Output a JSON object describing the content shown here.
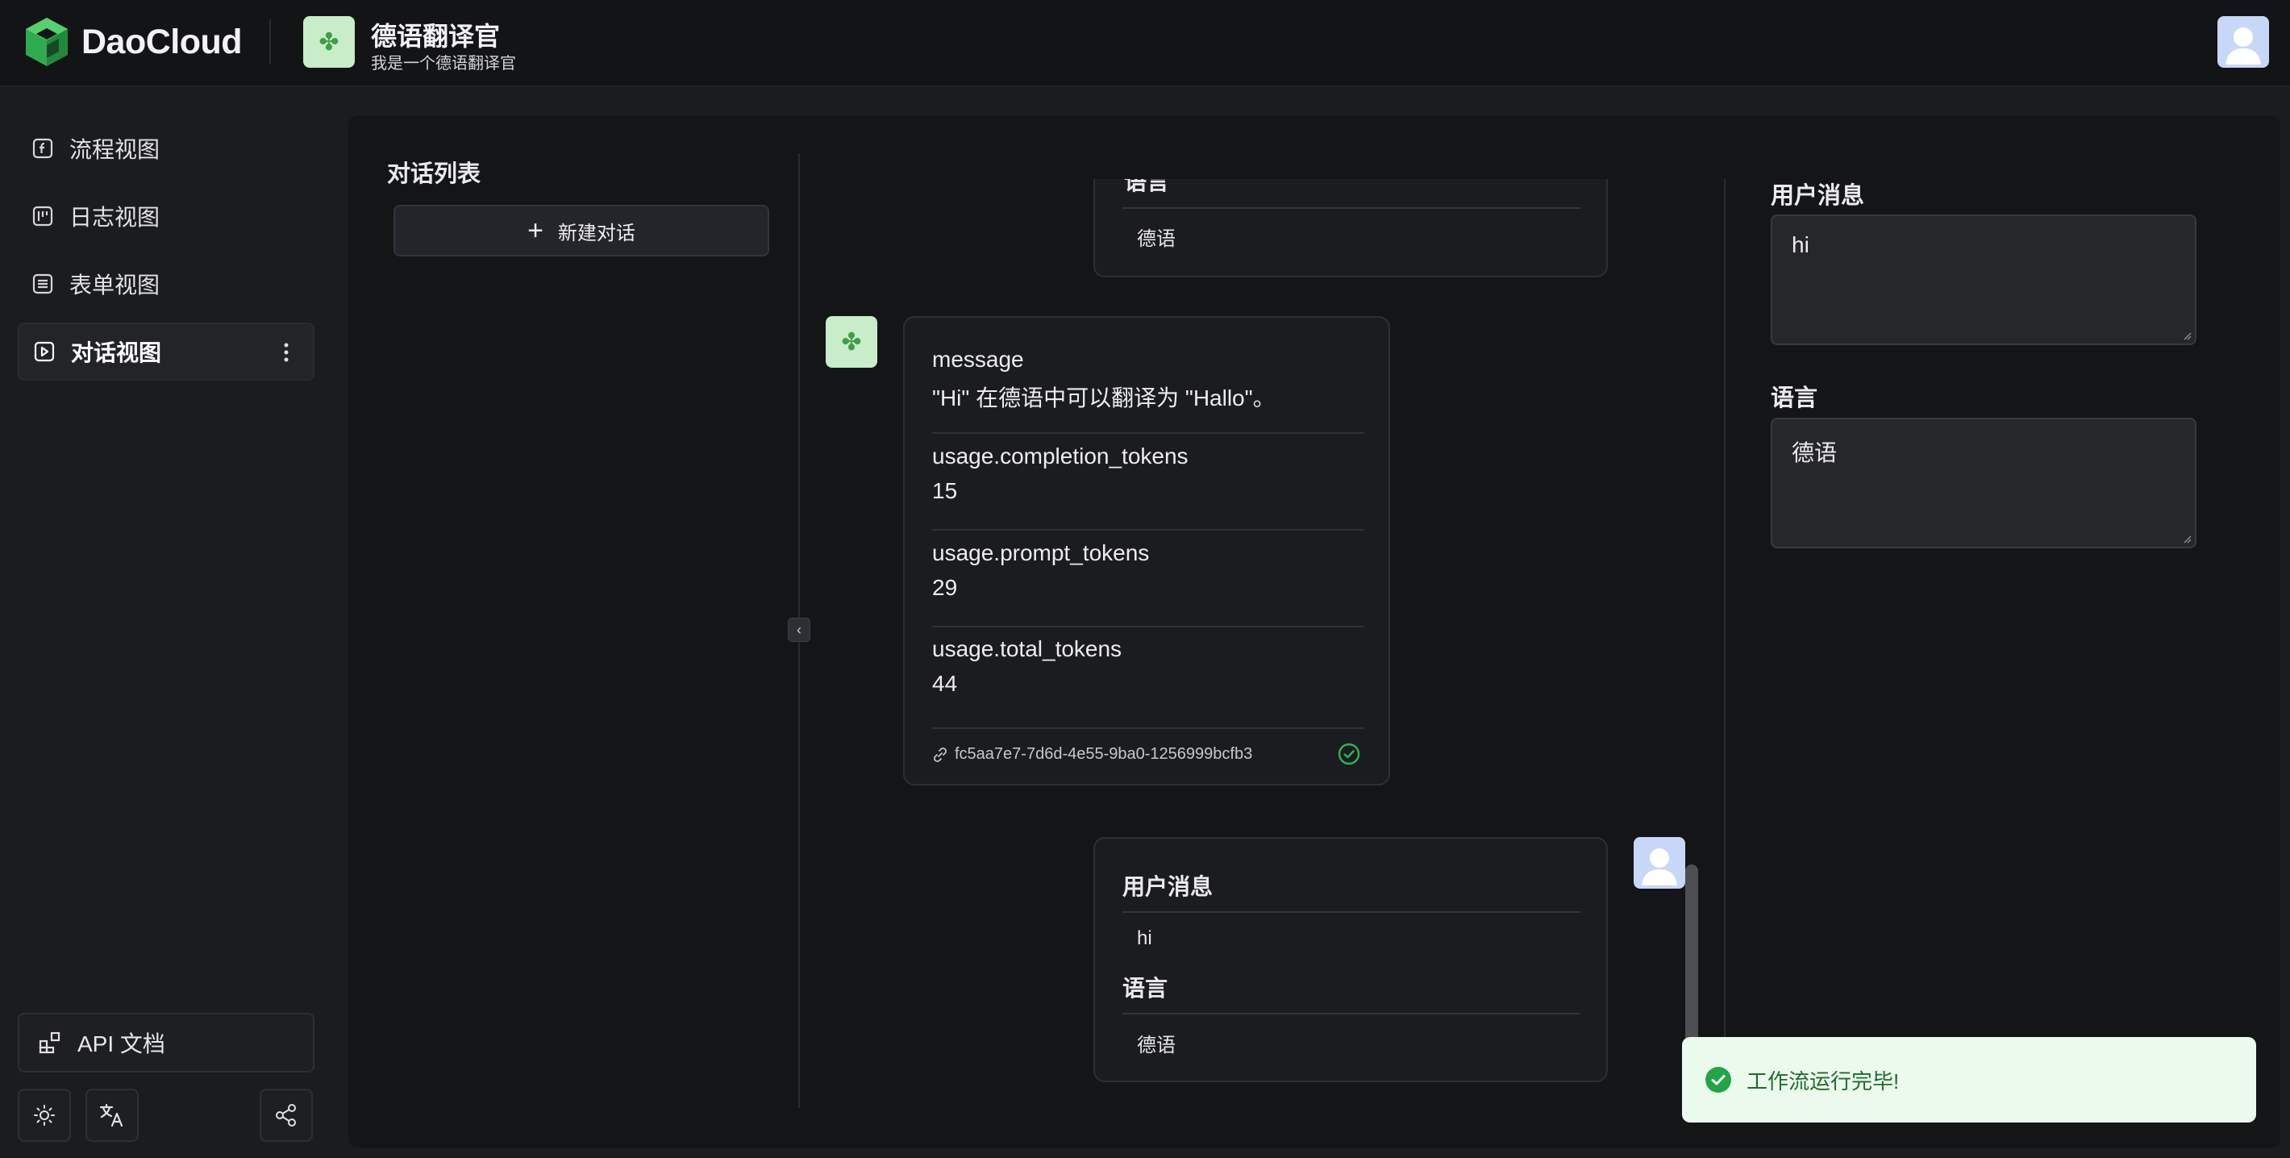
{
  "header": {
    "brand": "DaoCloud",
    "app_title": "德语翻译官",
    "app_subtitle": "我是一个德语翻译官"
  },
  "sidebar": {
    "items": [
      {
        "label": "流程视图",
        "icon": "flow-icon"
      },
      {
        "label": "日志视图",
        "icon": "log-icon"
      },
      {
        "label": "表单视图",
        "icon": "form-icon"
      },
      {
        "label": "对话视图",
        "icon": "chat-icon",
        "active": true
      }
    ],
    "api_docs": "API 文档"
  },
  "conversations": {
    "title": "对话列表",
    "new_button": "新建对话"
  },
  "chat": {
    "top_card": {
      "label": "语言",
      "value": "德语"
    },
    "bot_message": {
      "fields": [
        {
          "key": "message",
          "value": "\"Hi\" 在德语中可以翻译为 \"Hallo\"。"
        },
        {
          "key": "usage.completion_tokens",
          "value": "15"
        },
        {
          "key": "usage.prompt_tokens",
          "value": "29"
        },
        {
          "key": "usage.total_tokens",
          "value": "44"
        }
      ],
      "run_id": "fc5aa7e7-7d6d-4e55-9ba0-1256999bcfb3"
    },
    "user_message": {
      "fields": [
        {
          "label": "用户消息",
          "value": "hi"
        },
        {
          "label": "语言",
          "value": "德语"
        }
      ]
    }
  },
  "form": {
    "fields": [
      {
        "label": "用户消息",
        "value": "hi"
      },
      {
        "label": "语言",
        "value": "德语"
      }
    ]
  },
  "toast": {
    "message": "工作流运行完毕!",
    "status_color": "#22a447"
  },
  "colors": {
    "brand_green": "#3fbf5c",
    "app_icon_bg": "#c9ecc9",
    "avatar_bg": "#c7d7f7"
  }
}
